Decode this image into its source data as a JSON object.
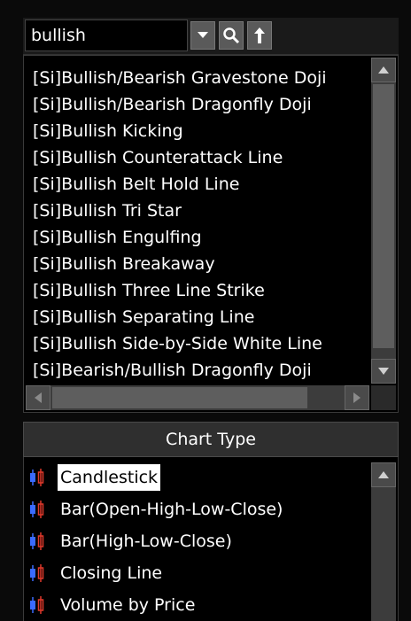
{
  "search": {
    "value": "bullish"
  },
  "toolbar": {
    "dropdown_icon": "chevron-down-icon",
    "search_icon": "search-icon",
    "up_icon": "arrow-up-icon"
  },
  "patterns": {
    "items": [
      "[Si]Bullish/Bearish Gravestone Doji",
      "[Si]Bullish/Bearish Dragonfly Doji",
      "[Si]Bullish Kicking",
      "[Si]Bullish Counterattack Line",
      "[Si]Bullish Belt Hold Line",
      "[Si]Bullish Tri Star",
      "[Si]Bullish Engulfing",
      "[Si]Bullish Breakaway",
      "[Si]Bullish Three Line Strike",
      "[Si]Bullish Separating Line",
      "[Si]Bullish Side-by-Side White Line",
      "[Si]Bearish/Bullish Dragonfly Doji"
    ]
  },
  "chart_type": {
    "header": "Chart Type",
    "selected": "Candlestick",
    "items": [
      "Candlestick",
      "Bar(Open-High-Low-Close)",
      "Bar(High-Low-Close)",
      "Closing Line",
      "Volume by Price"
    ],
    "icon": "candlestick-icon",
    "colors": {
      "up": "#3a6bff",
      "down": "#e0392b",
      "selected_bg": "#ffffff"
    }
  }
}
